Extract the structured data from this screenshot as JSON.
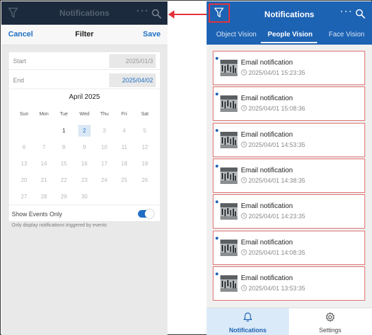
{
  "left_panel": {
    "app_title": "Notifications",
    "more_label": "···",
    "filter": {
      "cancel_label": "Cancel",
      "title": "Filter",
      "save_label": "Save",
      "start_label": "Start",
      "start_value": "2025/01/3",
      "end_label": "End",
      "end_value": "2025/04/02",
      "calendar": {
        "month_label": "April 2025",
        "weekdays": [
          "Sun",
          "Mon",
          "Tue",
          "Wed",
          "Thu",
          "Fri",
          "Sat"
        ],
        "days": [
          "1",
          "2",
          "3",
          "4",
          "5",
          "6",
          "7",
          "8",
          "9",
          "10",
          "11",
          "12",
          "13",
          "14",
          "15",
          "16",
          "17",
          "18",
          "19",
          "20",
          "21",
          "22",
          "23",
          "24",
          "25",
          "26",
          "27",
          "28",
          "29",
          "30"
        ],
        "selected_day": "2",
        "first_weekday_index": 2,
        "enabled_days": [
          "1",
          "2"
        ]
      },
      "show_events_label": "Show Events Only",
      "show_events_on": true,
      "hint": "Only display notifications triggered by events"
    }
  },
  "right_panel": {
    "app_title": "Notifications",
    "more_label": "···",
    "tabs": [
      {
        "label": "Object Vision",
        "active": false
      },
      {
        "label": "People Vision",
        "active": true
      },
      {
        "label": "Face Vision",
        "active": false
      }
    ],
    "notifications": [
      {
        "title": "Email notification",
        "time": "2025/04/01 15:23:35"
      },
      {
        "title": "Email notification",
        "time": "2025/04/01 15:08:36"
      },
      {
        "title": "Email notification",
        "time": "2025/04/01 14:53:35"
      },
      {
        "title": "Email notification",
        "time": "2025/04/01 14:38:35"
      },
      {
        "title": "Email notification",
        "time": "2025/04/01 14:23:35"
      },
      {
        "title": "Email notification",
        "time": "2025/04/01 14:08:35"
      },
      {
        "title": "Email notification",
        "time": "2025/04/01 13:53:35"
      }
    ],
    "bottom_nav": [
      {
        "label": "Notifications",
        "icon": "bell-icon",
        "active": true
      },
      {
        "label": "Settings",
        "icon": "gear-icon",
        "active": false
      }
    ]
  },
  "colors": {
    "header_dark": "#1c2a3d",
    "header_blue": "#1d63b4",
    "highlight_red": "#e3333a",
    "accent": "#1f6fc4"
  }
}
